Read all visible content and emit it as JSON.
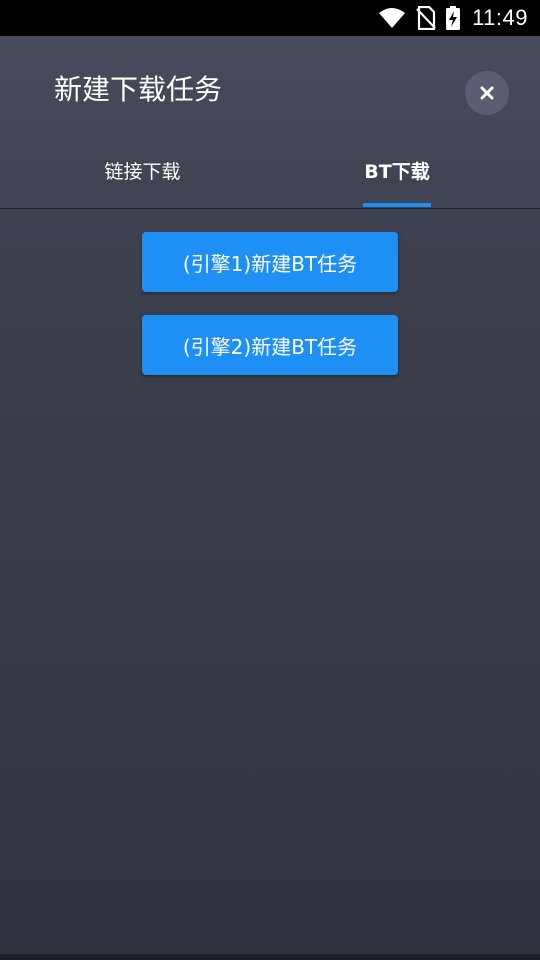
{
  "status_bar": {
    "time": "11:49",
    "icons": [
      "wifi-icon",
      "no-sim-icon",
      "battery-charging-icon"
    ]
  },
  "dialog": {
    "title": "新建下载任务",
    "close_icon": "close-icon"
  },
  "tabs": [
    {
      "label": "链接下载",
      "selected": false
    },
    {
      "label": "BT下载",
      "selected": true
    }
  ],
  "buttons": [
    {
      "label": "(引擎1)新建BT任务"
    },
    {
      "label": "(引擎2)新建BT任务"
    }
  ],
  "colors": {
    "accent": "#1e90f5",
    "background_top": "#474b5c",
    "background_bottom": "#30323d",
    "close_button": "#5b5e73"
  }
}
